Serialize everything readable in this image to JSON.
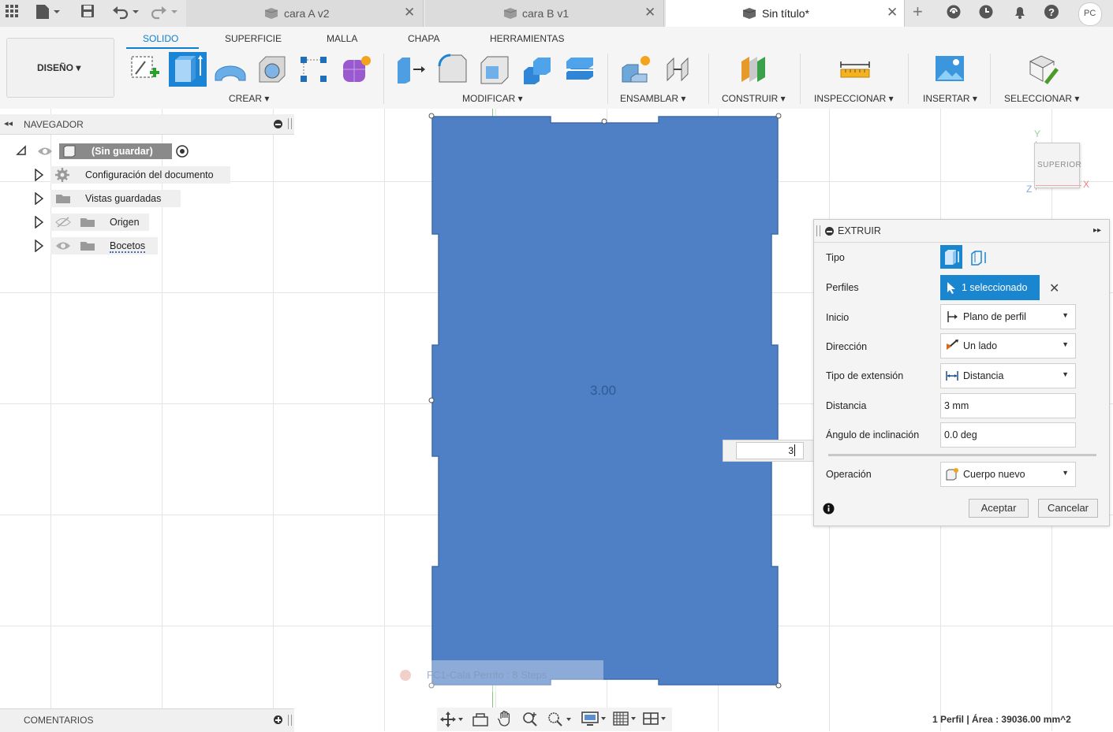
{
  "titlebar": {
    "tabs": [
      {
        "label": "cara A v2",
        "active": false
      },
      {
        "label": "cara B v1",
        "active": false
      },
      {
        "label": "Sin título*",
        "active": true
      }
    ],
    "user_initials": "PC"
  },
  "ribbon": {
    "workspace_button": "DISEÑO ▾",
    "tabs": [
      "SOLIDO",
      "SUPERFICIE",
      "MALLA",
      "CHAPA",
      "HERRAMIENTAS"
    ],
    "selected_tab": "SOLIDO",
    "groups": [
      "CREAR ▾",
      "MODIFICAR ▾",
      "ENSAMBLAR ▾",
      "CONSTRUIR ▾",
      "INSPECCIONAR ▾",
      "INSERTAR ▾",
      "SELECCIONAR ▾"
    ]
  },
  "navigator": {
    "title": "NAVEGADOR",
    "root": "(Sin guardar)",
    "items": [
      {
        "label": "Configuración del documento",
        "icon": "gear-icon"
      },
      {
        "label": "Vistas guardadas",
        "icon": "folder-icon"
      },
      {
        "label": "Origen",
        "icon": "folder-icon"
      },
      {
        "label": "Bocetos",
        "icon": "folder-icon"
      }
    ]
  },
  "viewcube": {
    "label": "SUPERIOR",
    "axis_y": "Y",
    "axis_x": "X",
    "axis_z": "Z"
  },
  "canvas": {
    "dimension_label": "3.00",
    "distance_input": "3",
    "toast_text": "FC1-Cala Perrito : 8 Steps"
  },
  "extrude_panel": {
    "title": "EXTRUIR",
    "rows": {
      "tipo": "Tipo",
      "perfiles": "Perfiles",
      "perfiles_value": "1 seleccionado",
      "inicio": "Inicio",
      "inicio_value": "Plano de perfil",
      "direccion": "Dirección",
      "direccion_value": "Un lado",
      "tipo_extension": "Tipo de extensión",
      "tipo_extension_value": "Distancia",
      "distancia": "Distancia",
      "distancia_value": "3 mm",
      "angulo": "Ángulo de inclinación",
      "angulo_value": "0.0 deg",
      "operacion": "Operación",
      "operacion_value": "Cuerpo nuevo"
    },
    "ok_label": "Aceptar",
    "cancel_label": "Cancelar"
  },
  "comments": {
    "title": "COMENTARIOS"
  },
  "status": {
    "text": "1 Perfil | Área : 39036.00 mm^2"
  },
  "colors": {
    "profile_fill": "#4f7fc4",
    "accent": "#0d7fd1",
    "perfiles_button": "#1b86d0"
  }
}
